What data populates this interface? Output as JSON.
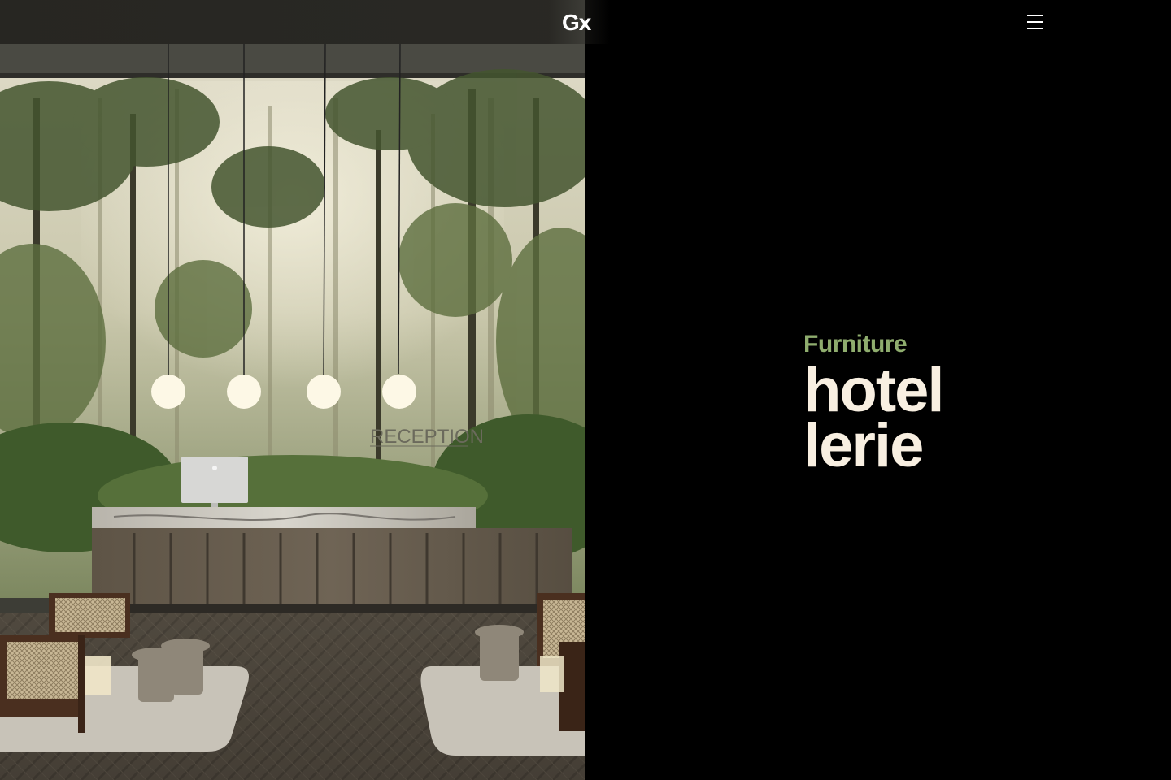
{
  "header": {
    "logo_text": "Gx",
    "menu_icon": "hamburger-menu-icon"
  },
  "hero": {
    "eyebrow": "Furniture",
    "title_line_1": "hotel",
    "title_line_2": "lerie"
  },
  "photo": {
    "sign_text": "RECEPTION",
    "description_colors": {
      "accent_green": "#8fad6e",
      "title_cream": "#f8efe1",
      "background": "#000000"
    }
  }
}
